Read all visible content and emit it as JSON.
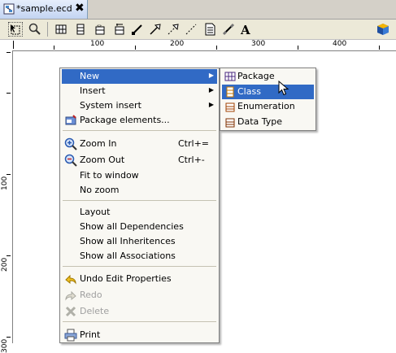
{
  "tab": {
    "title": "*sample.ecd",
    "close": "✖"
  },
  "ruler": {
    "top_labels": [
      "100",
      "200",
      "300",
      "400"
    ],
    "left_labels": [
      "100",
      "200",
      "300"
    ]
  },
  "menu": {
    "items": [
      {
        "label": "New",
        "submenu": true,
        "active": true
      },
      {
        "label": "Insert",
        "submenu": true
      },
      {
        "label": "System insert",
        "submenu": true
      },
      {
        "label": "Package elements...",
        "icon": "package-elements-icon"
      },
      {
        "label": "Zoom In",
        "accel": "Ctrl+=",
        "icon": "zoom-in-icon"
      },
      {
        "label": "Zoom Out",
        "accel": "Ctrl+-",
        "icon": "zoom-out-icon"
      },
      {
        "label": "Fit to window"
      },
      {
        "label": "No zoom"
      },
      {
        "label": "Layout"
      },
      {
        "label": "Show all Dependencies"
      },
      {
        "label": "Show all Inheritences"
      },
      {
        "label": "Show all Associations"
      },
      {
        "label": "Undo Edit Properties",
        "icon": "undo-icon"
      },
      {
        "label": "Redo",
        "icon": "redo-icon",
        "disabled": true
      },
      {
        "label": "Delete",
        "icon": "delete-icon",
        "disabled": true
      },
      {
        "label": "Print",
        "icon": "print-icon"
      }
    ]
  },
  "submenu": {
    "items": [
      {
        "label": "Package",
        "icon": "package-icon"
      },
      {
        "label": "Class",
        "icon": "class-icon",
        "active": true
      },
      {
        "label": "Enumeration",
        "icon": "enumeration-icon"
      },
      {
        "label": "Data Type",
        "icon": "data-type-icon"
      }
    ]
  },
  "colors": {
    "highlight": "#316ac5",
    "menu_bg": "#f9f8f3",
    "toolbar_bg": "#ece9d8"
  }
}
